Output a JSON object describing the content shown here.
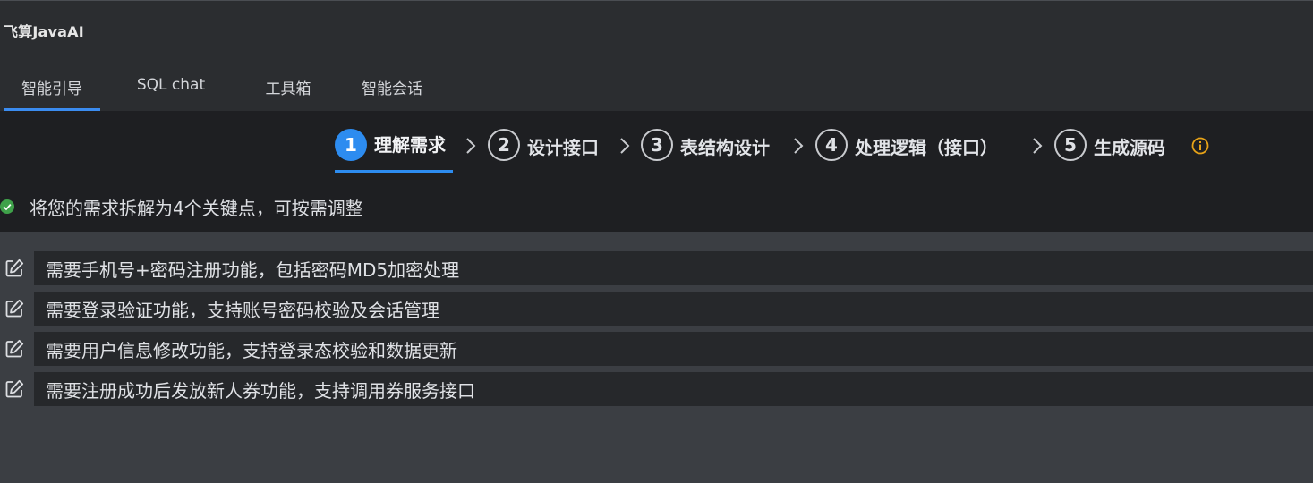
{
  "app": {
    "title": "飞算JavaAI"
  },
  "tabs": [
    {
      "label": "智能引导",
      "active": true
    },
    {
      "label": "SQL chat",
      "active": false
    },
    {
      "label": "工具箱",
      "active": false
    },
    {
      "label": "智能会话",
      "active": false
    }
  ],
  "steps": [
    {
      "number": "1",
      "label": "理解需求",
      "active": true
    },
    {
      "number": "2",
      "label": "设计接口",
      "active": false
    },
    {
      "number": "3",
      "label": "表结构设计",
      "active": false
    },
    {
      "number": "4",
      "label": "处理逻辑（接口）",
      "active": false
    },
    {
      "number": "5",
      "label": "生成源码",
      "active": false
    }
  ],
  "status": {
    "text": "将您的需求拆解为4个关键点，可按需调整",
    "icon": "check-circle-icon"
  },
  "requirements": [
    "需要手机号+密码注册功能，包括密码MD5加密处理",
    "需要登录验证功能，支持账号密码校验及会话管理",
    "需要用户信息修改功能，支持登录态校验和数据更新",
    "需要注册成功后发放新人券功能，支持调用券服务接口"
  ],
  "colors": {
    "accent": "#2d8cf0",
    "success": "#3fa14a",
    "warning": "#e8a317",
    "panel_dark": "#1e1f22",
    "header": "#2b2d30",
    "body": "#3b3e43"
  }
}
